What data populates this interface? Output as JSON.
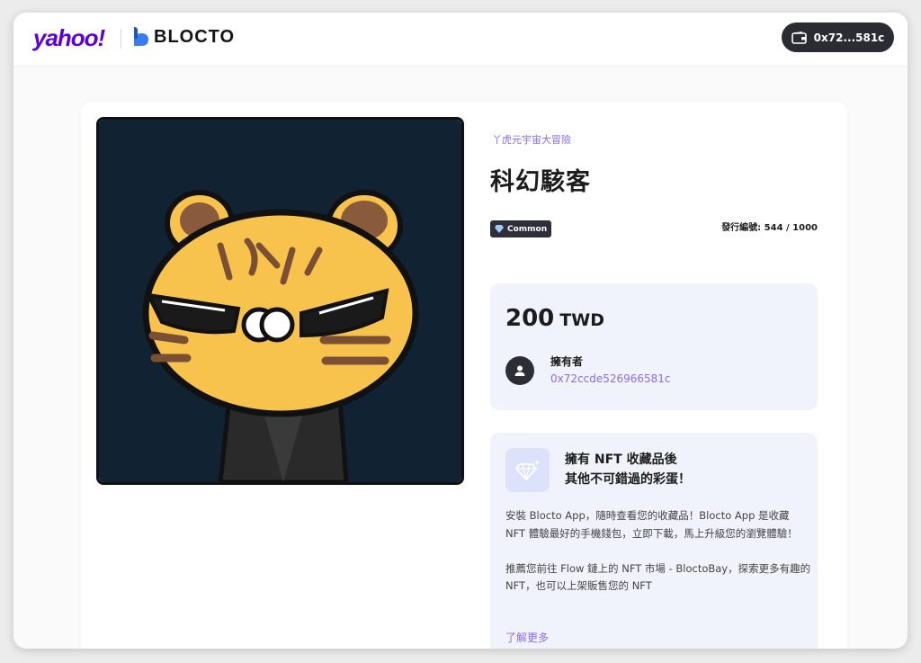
{
  "header": {
    "yahoo_logo": "yahoo!",
    "blocto_logo": "BLOCTO",
    "wallet_address": "0x72...581c"
  },
  "nft": {
    "collection": "丫虎元宇宙大冒險",
    "title": "科幻駭客",
    "rarity": "Common",
    "edition": "發行編號: 544 / 1000",
    "image": "tiger-hacker-illustration"
  },
  "price": {
    "amount": "200",
    "currency": "TWD"
  },
  "owner": {
    "label": "擁有者",
    "address": "0x72ccde526966581c"
  },
  "promo": {
    "title_line1": "擁有 NFT 收藏品後",
    "title_line2": "其他不可錯過的彩蛋！",
    "paragraph1": "安裝 Blocto App，隨時查看您的收藏品！Blocto App 是收藏 NFT 體驗最好的手機錢包，立即下載，馬上升級您的瀏覽體驗！",
    "paragraph2": "推薦您前往 Flow 鏈上的 NFT 市場 - BloctoBay，探索更多有趣的 NFT，也可以上架販售您的 NFT",
    "learn_more": "了解更多"
  },
  "colors": {
    "accent": "#8c6be6",
    "yahoo": "#6001d2",
    "dark": "#2b2b33",
    "panel": "#f1f3fc"
  },
  "icons": [
    "wallet-icon",
    "diamond-icon",
    "user-icon",
    "gem-sparkle-icon"
  ]
}
